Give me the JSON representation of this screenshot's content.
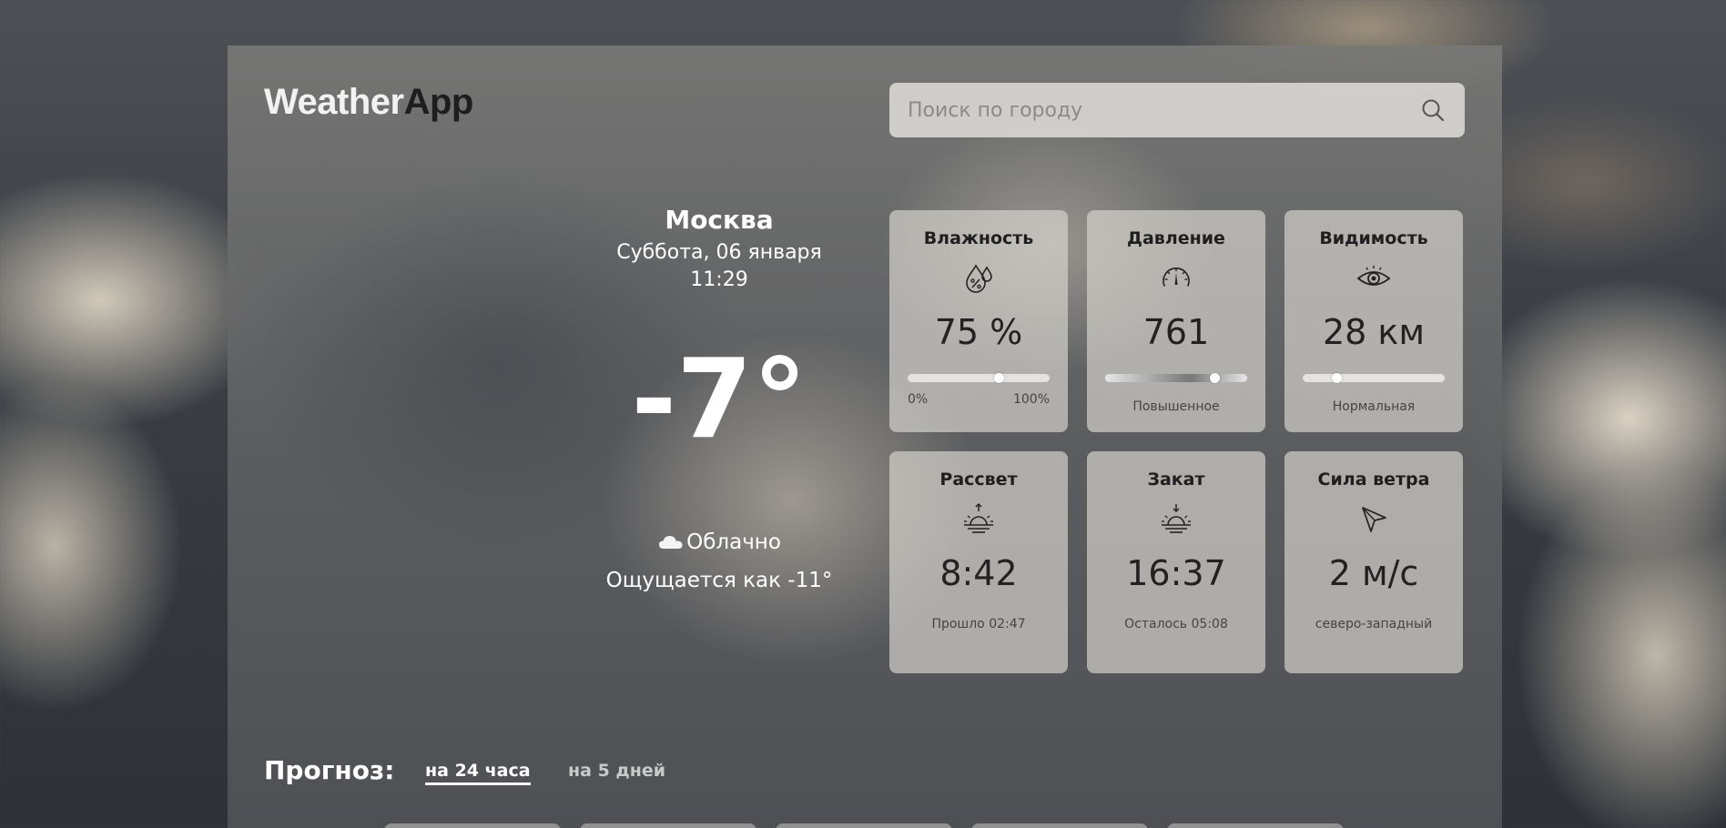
{
  "app": {
    "logo_part1": "Weather",
    "logo_part2": "App"
  },
  "search": {
    "placeholder": "Поиск по городу",
    "icon": "search-icon"
  },
  "current": {
    "city": "Москва",
    "date": "Суббота, 06 января",
    "time": "11:29",
    "temperature": "-7°",
    "condition": "Облачно",
    "condition_icon": "cloud-icon",
    "feels_like": "Ощущается как -11°"
  },
  "cards": {
    "humidity": {
      "title": "Влажность",
      "value": "75 %",
      "level": 0.64,
      "min_label": "0%",
      "max_label": "100%",
      "icon": "humidity-icon"
    },
    "pressure": {
      "title": "Давление",
      "value": "761",
      "level": 0.77,
      "note": "Повышенное",
      "icon": "gauge-icon"
    },
    "visibility": {
      "title": "Видимость",
      "value": "28 км",
      "level": 0.24,
      "note": "Нормальная",
      "icon": "eye-icon"
    },
    "sunrise": {
      "title": "Рассвет",
      "value": "8:42",
      "note": "Прошло 02:47",
      "icon": "sunrise-icon"
    },
    "sunset": {
      "title": "Закат",
      "value": "16:37",
      "note": "Осталось 05:08",
      "icon": "sunset-icon"
    },
    "wind": {
      "title": "Сила ветра",
      "value": "2 м/с",
      "note": "северо-западный",
      "icon": "wind-direction-icon"
    }
  },
  "forecast": {
    "title": "Прогноз:",
    "tabs": [
      "на 24 часа",
      "на 5 дней"
    ],
    "active_tab": 0
  },
  "colors": {
    "text_light": "#ffffff",
    "text_dark": "#1f1f1f",
    "card_bg": "#d7d4ce"
  }
}
